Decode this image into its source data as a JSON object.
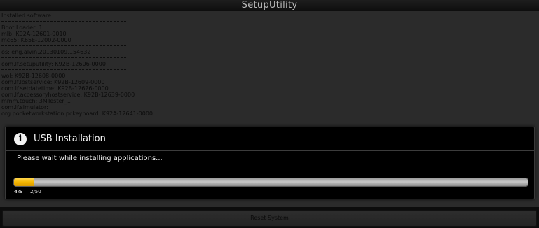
{
  "window": {
    "title": "SetupUtility"
  },
  "installed": {
    "heading": "Installed software",
    "lines_1": [
      "Boot Loader: 1",
      "mlb: K92A-12601-0010",
      "mc65: K65E-12002-0000"
    ],
    "lines_2": [
      "os: eng.alvin.20130109.154632"
    ],
    "lines_3": [
      "com.lf.setuputility: K92B-12606-0000"
    ],
    "lines_4": [
      "wol: K92B-12608-0000",
      "com.lf.lostservice: K92B-12609-0000",
      "com.lf.setdatetime: K92B-12626-0000",
      "com.lf.accessoryhostservice: K92B-12639-0000",
      "mmm.touch: 3MTester_1",
      "com.lf.simulator:",
      "org.pocketworkstation.pckeyboard: K92A-12641-0000"
    ]
  },
  "dialog": {
    "title": "USB Installation",
    "message": "Please wait while installing applications...",
    "progress_percent_label": "4%",
    "progress_count_label": "2/50",
    "progress_fraction": 0.04
  },
  "footer": {
    "reset_label": "Reset System"
  },
  "colors": {
    "progress": "#f2b400",
    "dialog_bg": "#000000",
    "panel_bg": "#2b2b2b"
  },
  "icons": {
    "dialog_icon": "info-icon"
  }
}
